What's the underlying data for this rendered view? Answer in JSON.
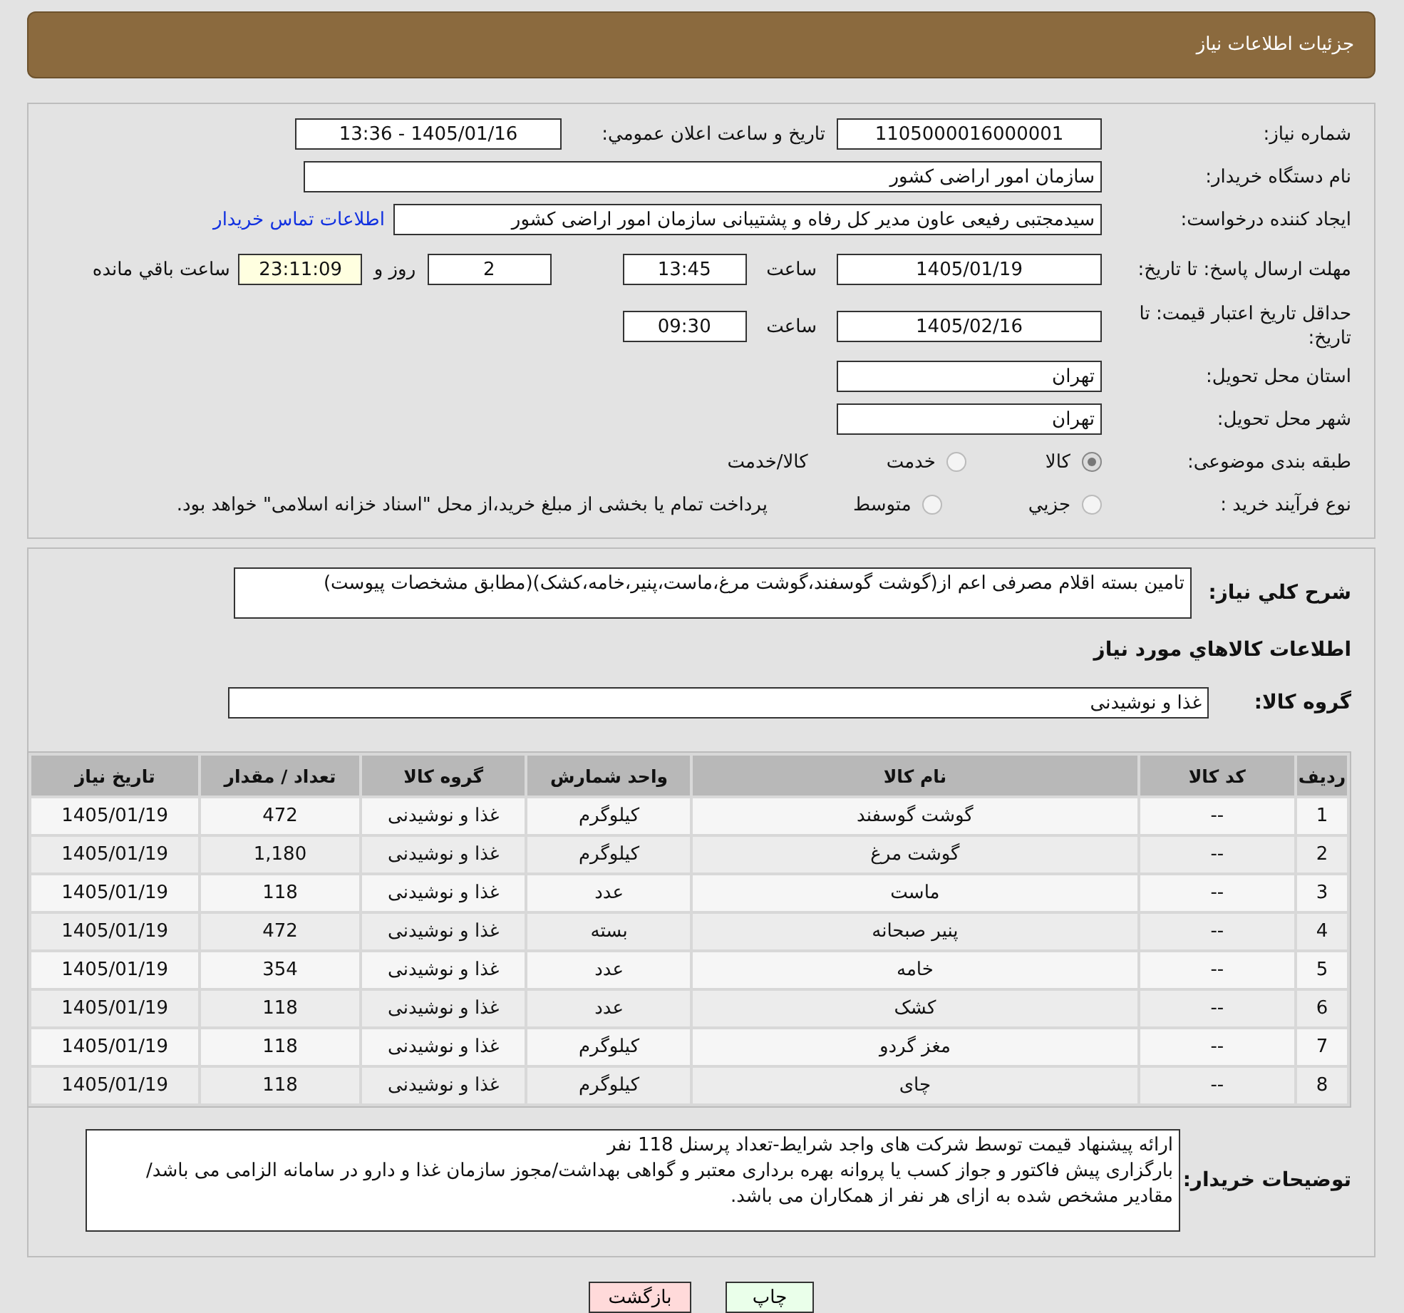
{
  "header": {
    "title": "جزئیات اطلاعات نیاز"
  },
  "need_number": {
    "label": "شماره نیاز:",
    "value": "1105000016000001"
  },
  "announce": {
    "label": "تاریخ و ساعت اعلان عمومي:",
    "value": "1405/01/16 - 13:36"
  },
  "buyer_org": {
    "label": "نام دستگاه خریدار:",
    "value": "سازمان امور اراضی کشور"
  },
  "requester": {
    "label": "ایجاد کننده درخواست:",
    "value": "سیدمجتبی رفیعی عاون مدیر کل رفاه و پشتیبانی سازمان امور اراضی کشور",
    "link": "اطلاعات تماس خریدار"
  },
  "deadline": {
    "label": "مهلت ارسال پاسخ: تا تاریخ:",
    "date": "1405/01/19",
    "time_label": "ساعت",
    "time": "13:45",
    "days": "2",
    "days_label": "روز و",
    "remaining": "23:11:09",
    "remaining_label": "ساعت باقي مانده"
  },
  "validity": {
    "label": "حداقل تاریخ اعتبار قیمت: تا تاریخ:",
    "date": "1405/02/16",
    "time_label": "ساعت",
    "time": "09:30"
  },
  "province": {
    "label": "استان محل تحویل:",
    "value": "تهران"
  },
  "city": {
    "label": "شهر محل تحویل:",
    "value": "تهران"
  },
  "category": {
    "label": "طبقه بندی موضوعی:",
    "options": [
      {
        "label": "کالا",
        "kind": "radio",
        "selected": true
      },
      {
        "label": "خدمت",
        "kind": "radio",
        "selected": false
      },
      {
        "label": "کالا/خدمت",
        "kind": "text"
      }
    ]
  },
  "purchase_type": {
    "label": "نوع فرآیند خرید :",
    "options": [
      {
        "label": "جزيي",
        "selected": false
      },
      {
        "label": "متوسط",
        "selected": false
      }
    ],
    "note": "پرداخت تمام یا بخشی از مبلغ خرید،از محل \"اسناد خزانه اسلامی\" خواهد بود."
  },
  "summary": {
    "label": "شرح کلي نياز:",
    "value": "تامین بسته اقلام مصرفی اعم از(گوشت گوسفند،گوشت مرغ،ماست،پنیر،خامه،کشک)(مطابق مشخصات پیوست)"
  },
  "items_heading": "اطلاعات کالاهاي مورد نياز",
  "goods_group": {
    "label": "گروه کالا:",
    "value": "غذا و نوشیدنی"
  },
  "table": {
    "columns": [
      "ردیف",
      "کد کالا",
      "نام کالا",
      "واحد شمارش",
      "گروه کالا",
      "تعداد / مقدار",
      "تاریخ نیاز"
    ],
    "rows": [
      [
        "1",
        "--",
        "گوشت گوسفند",
        "کیلوگرم",
        "غذا و نوشیدنی",
        "472",
        "1405/01/19"
      ],
      [
        "2",
        "--",
        "گوشت مرغ",
        "کیلوگرم",
        "غذا و نوشیدنی",
        "1,180",
        "1405/01/19"
      ],
      [
        "3",
        "--",
        "ماست",
        "عدد",
        "غذا و نوشیدنی",
        "118",
        "1405/01/19"
      ],
      [
        "4",
        "--",
        "پنیر صبحانه",
        "بسته",
        "غذا و نوشیدنی",
        "472",
        "1405/01/19"
      ],
      [
        "5",
        "--",
        "خامه",
        "عدد",
        "غذا و نوشیدنی",
        "354",
        "1405/01/19"
      ],
      [
        "6",
        "--",
        "کشک",
        "عدد",
        "غذا و نوشیدنی",
        "118",
        "1405/01/19"
      ],
      [
        "7",
        "--",
        "مغز گردو",
        "کیلوگرم",
        "غذا و نوشیدنی",
        "118",
        "1405/01/19"
      ],
      [
        "8",
        "--",
        "چای",
        "کیلوگرم",
        "غذا و نوشیدنی",
        "118",
        "1405/01/19"
      ]
    ]
  },
  "buyer_notes": {
    "label": "توضیحات خریدار:",
    "lines": [
      "ارائه پیشنهاد قیمت توسط شرکت های واجد شرایط-تعداد پرسنل 118 نفر",
      "بارگزاری پیش فاکتور و جواز کسب یا پروانه بهره برداری معتبر و گواهی بهداشت/مجوز سازمان غذا و دارو در سامانه الزامی می باشد/مقادیر مشخص شده به ازای هر نفر از همکاران می باشد."
    ]
  },
  "buttons": [
    {
      "label": "چاپ",
      "kind": "print"
    },
    {
      "label": "بازگشت",
      "kind": "back"
    }
  ]
}
